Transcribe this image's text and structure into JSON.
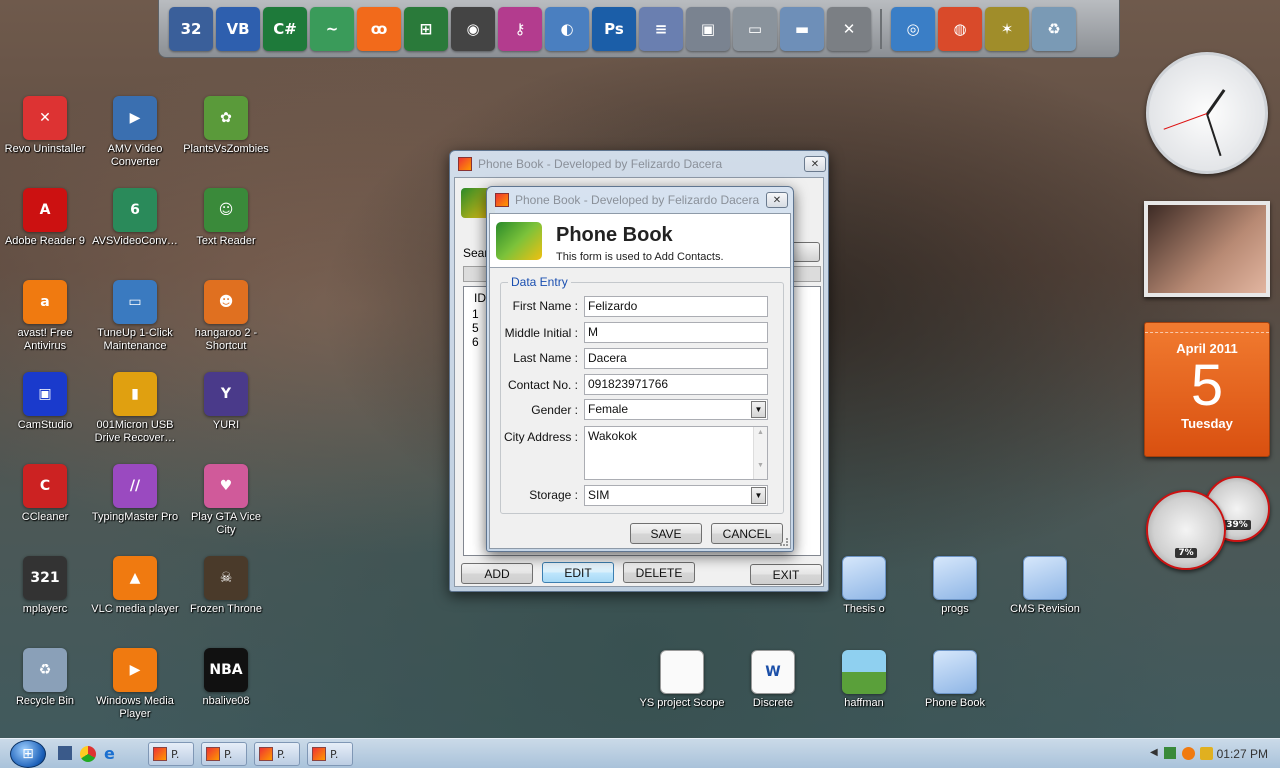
{
  "dock": {
    "icons": [
      {
        "name": "vb6-icon",
        "glyph": "32",
        "color": "#3a5f9a"
      },
      {
        "name": "visual-basic-icon",
        "glyph": "VB",
        "color": "#2e5fae"
      },
      {
        "name": "csharp-icon",
        "glyph": "C#",
        "color": "#1e7a3a"
      },
      {
        "name": "dreamweaver-icon",
        "glyph": "~",
        "color": "#3a9b5a"
      },
      {
        "name": "xampp-icon",
        "glyph": "ꝏ",
        "color": "#f26a1b"
      },
      {
        "name": "network-diagram-icon",
        "glyph": "⊞",
        "color": "#2a7a3a"
      },
      {
        "name": "nero-icon",
        "glyph": "◉",
        "color": "#444444"
      },
      {
        "name": "key-icon",
        "glyph": "⚷",
        "color": "#b33c8e"
      },
      {
        "name": "mysql-icon",
        "glyph": "◐",
        "color": "#4a7fc0"
      },
      {
        "name": "photoshop-icon",
        "glyph": "Ps",
        "color": "#1b5ea8"
      },
      {
        "name": "notepad-icon",
        "glyph": "≡",
        "color": "#6a7fb0"
      },
      {
        "name": "toolbox-icon",
        "glyph": "▣",
        "color": "#7a8390"
      },
      {
        "name": "computer-icon",
        "glyph": "▭",
        "color": "#8a939c"
      },
      {
        "name": "folder-icon",
        "glyph": "▬",
        "color": "#6e8fb8"
      },
      {
        "name": "tools-icon",
        "glyph": "✕",
        "color": "#7b7f84"
      },
      {
        "name": "network-icon",
        "glyph": "◎",
        "color": "#3a7ec6"
      },
      {
        "name": "chrome-icon",
        "glyph": "◍",
        "color": "#d94a2a"
      },
      {
        "name": "rays-icon",
        "glyph": "✶",
        "color": "#a08d2a"
      },
      {
        "name": "recycle-bin-icon",
        "glyph": "♻",
        "color": "#7a9ab5"
      }
    ]
  },
  "desktop": {
    "icons": [
      {
        "label": "Revo Uninstaller",
        "icon": "revo-uninstaller-icon",
        "color": "#d33",
        "glyph": "✕"
      },
      {
        "label": "AMV Video Converter",
        "icon": "amv-converter-icon",
        "color": "#3a6fb0",
        "glyph": "▶"
      },
      {
        "label": "PlantsVsZombies",
        "icon": "plants-vs-zombies-icon",
        "color": "#5a9a3a",
        "glyph": "✿"
      },
      {
        "label": "Adobe Reader 9",
        "icon": "adobe-reader-icon",
        "color": "#c11",
        "glyph": "A"
      },
      {
        "label": "AVSVideoConv…",
        "icon": "avs-video-converter-icon",
        "color": "#2a8a5a",
        "glyph": "6"
      },
      {
        "label": "Text Reader",
        "icon": "text-reader-icon",
        "color": "#3a8a3a",
        "glyph": "☺"
      },
      {
        "label": "avast! Free Antivirus",
        "icon": "avast-icon",
        "color": "#f07a10",
        "glyph": "a"
      },
      {
        "label": "TuneUp 1-Click Maintenance",
        "icon": "tuneup-icon",
        "color": "#3a7ac0",
        "glyph": "▭"
      },
      {
        "label": "hangaroo 2 - Shortcut",
        "icon": "hangaroo-icon",
        "color": "#e07020",
        "glyph": "☻"
      },
      {
        "label": "CamStudio",
        "icon": "camstudio-icon",
        "color": "#1a3acc",
        "glyph": "▣"
      },
      {
        "label": "001Micron USB Drive Recover…",
        "icon": "usb-drive-icon",
        "color": "#e0a010",
        "glyph": "▮"
      },
      {
        "label": "YURI",
        "icon": "yuri-icon",
        "color": "#4a3a8a",
        "glyph": "Y"
      },
      {
        "label": "CCleaner",
        "icon": "ccleaner-icon",
        "color": "#c22",
        "glyph": "C"
      },
      {
        "label": "TypingMaster Pro",
        "icon": "typingmaster-icon",
        "color": "#9a4ac0",
        "glyph": "//"
      },
      {
        "label": "Play GTA Vice City",
        "icon": "gta-vice-city-icon",
        "color": "#d05a9a",
        "glyph": "♥"
      },
      {
        "label": "mplayerc",
        "icon": "mplayerc-icon",
        "color": "#333",
        "glyph": "321"
      },
      {
        "label": "VLC media player",
        "icon": "vlc-icon",
        "color": "#f07a10",
        "glyph": "▲"
      },
      {
        "label": "Frozen Throne",
        "icon": "frozen-throne-icon",
        "color": "#4a3a2a",
        "glyph": "☠"
      },
      {
        "label": "Recycle Bin",
        "icon": "recycle-bin-icon",
        "color": "#8aa0b8",
        "glyph": "♻"
      },
      {
        "label": "Windows Media Player",
        "icon": "windows-media-player-icon",
        "color": "#f07a10",
        "glyph": "▶"
      },
      {
        "label": "nbalive08",
        "icon": "nbalive08-icon",
        "color": "#111",
        "glyph": "NBA"
      }
    ],
    "files": [
      {
        "label": "YS project Scope",
        "icon": "text-file-icon",
        "kind": "doc"
      },
      {
        "label": "Discrete",
        "icon": "word-document-icon",
        "kind": "word"
      },
      {
        "label": "haffman",
        "icon": "image-file-icon",
        "kind": "image"
      },
      {
        "label": "Thesis o",
        "icon": "folder-icon",
        "kind": "folder"
      },
      {
        "label": "progs",
        "icon": "folder-icon",
        "kind": "folder"
      },
      {
        "label": "CMS Revision",
        "icon": "folder-icon",
        "kind": "folder"
      },
      {
        "label": "Phone Book",
        "icon": "folder-icon",
        "kind": "folder"
      }
    ]
  },
  "gadgets": {
    "calendar": {
      "month": "April 2011",
      "day": "5",
      "weekday": "Tuesday"
    },
    "meters": {
      "cpu": "7%",
      "memory": "39%"
    }
  },
  "main_window": {
    "title": "Phone Book  - Developed by Felizardo Dacera",
    "search_label": "Searc",
    "list_header": "ID",
    "list_ids": [
      "1",
      "5",
      "6"
    ],
    "buttons": {
      "add": "ADD",
      "edit": "EDIT",
      "delete": "DELETE",
      "exit": "EXIT"
    }
  },
  "dialog": {
    "title": "Phone Book - Developed by Felizardo Dacera",
    "header_title": "Phone Book",
    "header_subtitle": "This form is used to Add Contacts.",
    "group_label": "Data Entry",
    "labels": {
      "first_name": "First Name :",
      "middle_initial": "Middle Initial :",
      "last_name": "Last Name :",
      "contact_no": "Contact No. :",
      "gender": "Gender :",
      "city_address": "City Address :",
      "storage": "Storage :"
    },
    "values": {
      "first_name": "Felizardo",
      "middle_initial": "M",
      "last_name": "Dacera",
      "contact_no": "091823971766",
      "gender": "Female",
      "city_address": "Wakokok",
      "storage": "SIM"
    },
    "buttons": {
      "save": "SAVE",
      "cancel": "CANCEL"
    }
  },
  "taskbar": {
    "tasks": [
      "P.",
      "P.",
      "P.",
      "P."
    ],
    "clock": "01:27 PM"
  }
}
